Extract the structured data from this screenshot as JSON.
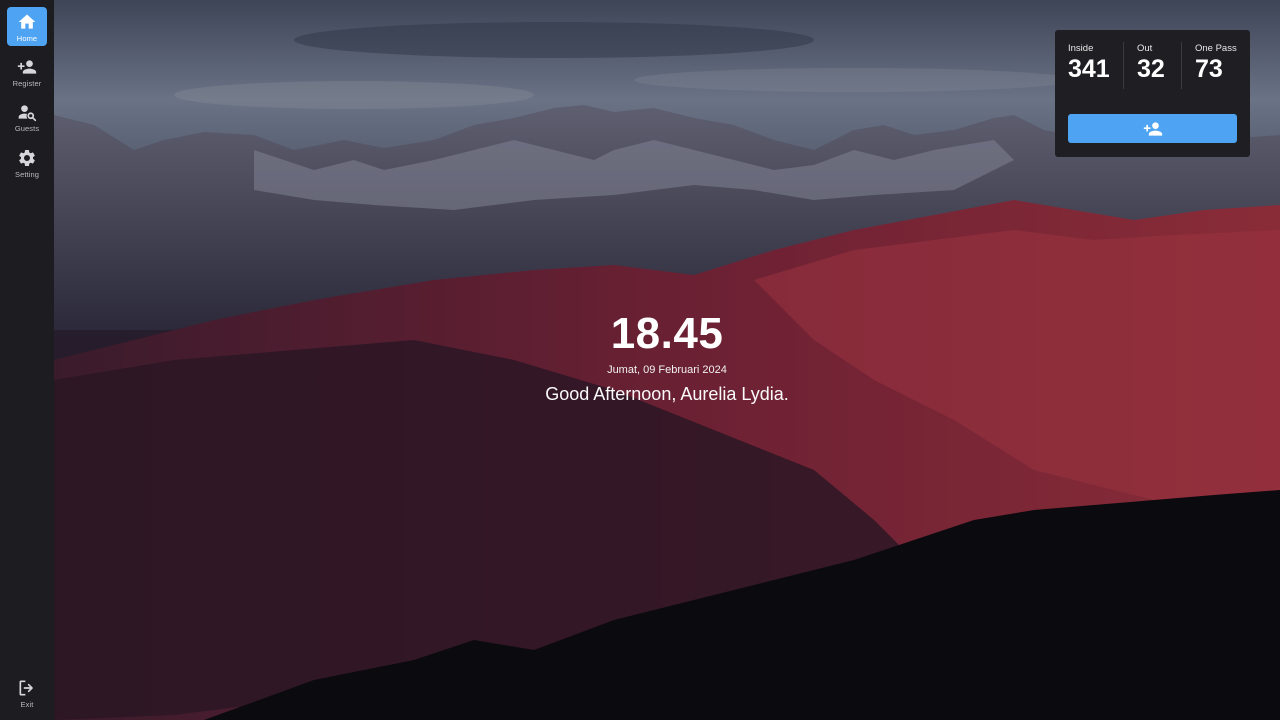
{
  "sidebar": {
    "items": [
      {
        "label": "Home",
        "icon": "home-icon",
        "active": true
      },
      {
        "label": "Register",
        "icon": "person-add-icon"
      },
      {
        "label": "Guests",
        "icon": "person-search-icon"
      },
      {
        "label": "Setting",
        "icon": "gear-icon"
      }
    ],
    "exit": {
      "label": "Exit",
      "icon": "logout-icon"
    }
  },
  "main": {
    "time": "18.45",
    "date": "Jumat, 09 Februari 2024",
    "greeting": "Good Afternoon, Aurelia Lydia."
  },
  "stats": {
    "inside": {
      "label": "Inside",
      "value": "341"
    },
    "out": {
      "label": "Out",
      "value": "32"
    },
    "one_pass": {
      "label": "One Pass",
      "value": "73"
    },
    "add_button_icon": "person-add-icon"
  },
  "colors": {
    "accent": "#4ea4f2",
    "sidebar_bg": "#1c1c21",
    "panel_bg": "#1e1e23"
  }
}
